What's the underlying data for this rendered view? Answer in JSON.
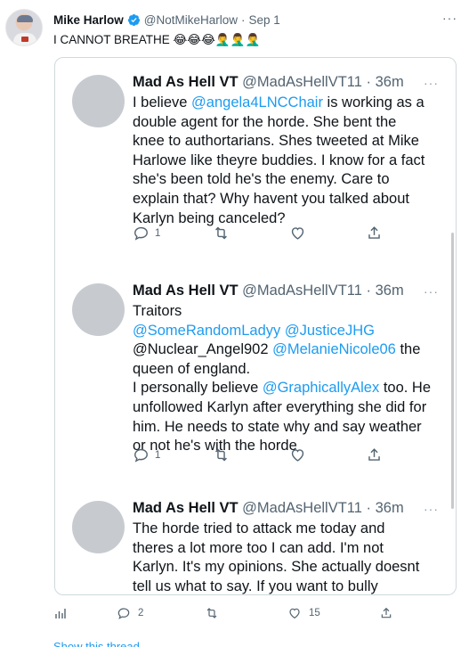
{
  "outer_tweet": {
    "name": "Mike Harlow",
    "handle": "@NotMikeHarlow",
    "date": "Sep 1",
    "text": "I CANNOT BREATHE 😂😂😂🤦‍♂️🤦‍♂️🤦‍♂️",
    "counts": {
      "replies": "2",
      "likes": "15"
    },
    "show_thread": "Show this thread"
  },
  "replies": [
    {
      "name": "Mad As Hell VT",
      "handle": "@MadAsHellVT11",
      "time": "36m",
      "lines": [
        [
          {
            "t": "I believe "
          },
          {
            "t": "@angela4LNCChair",
            "m": true
          },
          {
            "t": " is working as a"
          }
        ],
        [
          {
            "t": "double agent for the horde. She bent the"
          }
        ],
        [
          {
            "t": "knee to authortarians. Shes tweeted at Mike"
          }
        ],
        [
          {
            "t": "Harlowe like theyre buddies. I know for a fact"
          }
        ],
        [
          {
            "t": "she's been told he's the enemy. Care to"
          }
        ],
        [
          {
            "t": "explain that? Why havent you talked about"
          }
        ],
        [
          {
            "t": "Karlyn being canceled?"
          }
        ]
      ],
      "reply_count": "1"
    },
    {
      "name": "Mad As Hell VT",
      "handle": "@MadAsHellVT11",
      "time": "36m",
      "lines": [
        [
          {
            "t": "Traitors"
          }
        ],
        [
          {
            "t": "@SomeRandomLadyy",
            "m": true
          },
          {
            "t": " "
          },
          {
            "t": "@JusticeJHG",
            "m": true
          }
        ],
        [
          {
            "t": "@Nuclear_Angel902 "
          },
          {
            "t": "@MelanieNicole06",
            "m": true
          },
          {
            "t": " the"
          }
        ],
        [
          {
            "t": "queen of england."
          }
        ],
        [
          {
            "t": "I personally believe "
          },
          {
            "t": "@GraphicallyAlex",
            "m": true
          },
          {
            "t": " too. He"
          }
        ],
        [
          {
            "t": "unfollowed Karlyn after everything she did for"
          }
        ],
        [
          {
            "t": "him. He needs to state why and say weather"
          }
        ],
        [
          {
            "t": "or not he's with the horde"
          }
        ]
      ],
      "reply_count": "1"
    },
    {
      "name": "Mad As Hell VT",
      "handle": "@MadAsHellVT11",
      "time": "36m",
      "lines": [
        [
          {
            "t": "The horde tried to attack me today and"
          }
        ],
        [
          {
            "t": "theres a lot more too I can add. I'm not"
          }
        ],
        [
          {
            "t": "Karlyn. It's my opinions. She actually doesnt"
          }
        ],
        [
          {
            "t": "tell us what to say. If you want to bully"
          }
        ]
      ],
      "reply_count": ""
    }
  ]
}
